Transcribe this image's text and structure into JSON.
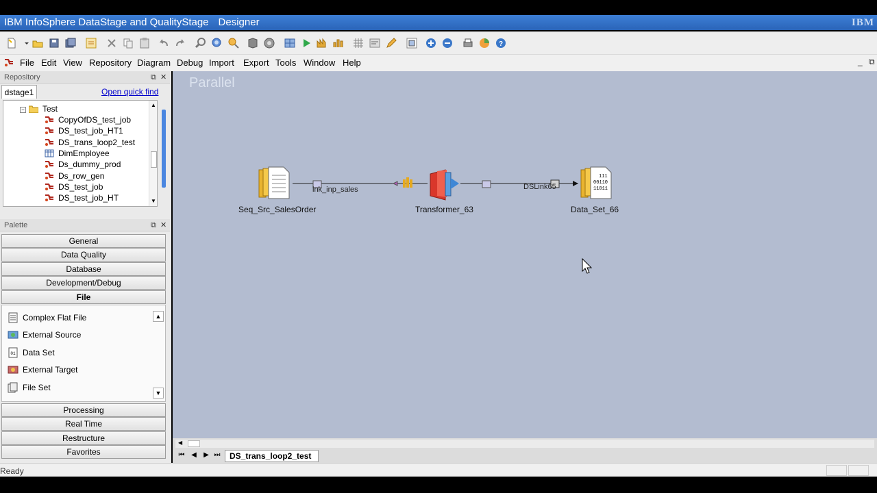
{
  "window": {
    "title": "IBM InfoSphere DataStage and QualityStage",
    "subtitle": "Designer",
    "logo": "IBM"
  },
  "menu": [
    "File",
    "Edit",
    "View",
    "Repository",
    "Diagram",
    "Debug",
    "Import",
    "Export",
    "Tools",
    "Window",
    "Help"
  ],
  "repository": {
    "header": "Repository",
    "tab": "dstage1",
    "quick_find": "Open quick find",
    "folder": "Test",
    "items": [
      {
        "label": "CopyOfDS_test_job",
        "icon": "job-icon"
      },
      {
        "label": "DS_test_job_HT1",
        "icon": "job-icon"
      },
      {
        "label": "DS_trans_loop2_test",
        "icon": "job-icon"
      },
      {
        "label": "DimEmployee",
        "icon": "table-definition-icon"
      },
      {
        "label": "Ds_dummy_prod",
        "icon": "job-icon"
      },
      {
        "label": "Ds_row_gen",
        "icon": "job-icon"
      },
      {
        "label": "DS_test_job",
        "icon": "job-icon"
      },
      {
        "label": "DS_test_job_HT",
        "icon": "job-icon"
      }
    ]
  },
  "palette": {
    "header": "Palette",
    "categories_top": [
      "General",
      "Data Quality",
      "Database",
      "Development/Debug",
      "File"
    ],
    "active_category": "File",
    "items": [
      {
        "label": "Complex Flat File",
        "icon": "complex-flat-file-icon"
      },
      {
        "label": "External Source",
        "icon": "external-source-icon"
      },
      {
        "label": "Data Set",
        "icon": "data-set-icon"
      },
      {
        "label": "External Target",
        "icon": "external-target-icon"
      },
      {
        "label": "File Set",
        "icon": "file-set-icon"
      }
    ],
    "categories_bottom": [
      "Processing",
      "Real Time",
      "Restructure",
      "Favorites"
    ]
  },
  "canvas": {
    "mode_label": "Parallel",
    "stages": {
      "source": "Seq_Src_SalesOrder",
      "transformer": "Transformer_63",
      "target": "Data_Set_66"
    },
    "links": {
      "input": "lnk_inp_sales",
      "output": "DSLink65"
    },
    "target_icon_text": [
      "111",
      "00110",
      "11011"
    ]
  },
  "job_tab": "DS_trans_loop2_test",
  "status": "Ready",
  "colors": {
    "titlebar": "#2f6fc7",
    "canvas": "#b3bcd0",
    "transformer": "#d9372b"
  }
}
